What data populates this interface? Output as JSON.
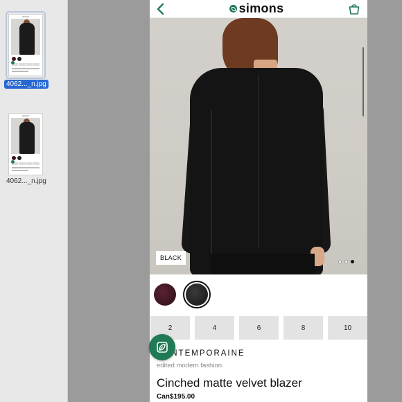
{
  "sidebar": {
    "files": [
      {
        "label": "4062..._n.jpg",
        "selected": true
      },
      {
        "label": "4062..._n.jpg",
        "selected": false
      }
    ]
  },
  "app": {
    "logo_text": "simons",
    "back_icon": "chevron-left-icon",
    "bag_icon": "shopping-bag-icon",
    "accent_color": "#1f7a55",
    "product": {
      "color_label": "BLACK",
      "carousel": {
        "count": 3,
        "active_index": 2
      },
      "swatches": [
        {
          "name": "burgundy",
          "color": "#3b1620",
          "selected": false
        },
        {
          "name": "black",
          "color": "#222222",
          "selected": true
        }
      ],
      "sizes": [
        "2",
        "4",
        "6",
        "8",
        "10"
      ],
      "brand": "CONTEMPORAINE",
      "tagline": "edited modern fashion",
      "title": "Cinched matte velvet blazer",
      "price": "Can$195.00"
    }
  }
}
